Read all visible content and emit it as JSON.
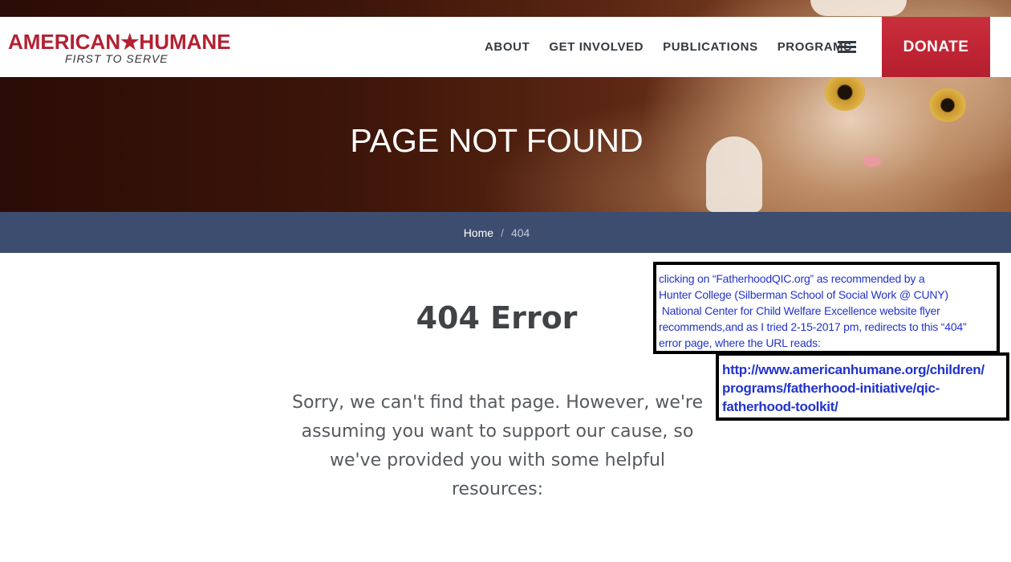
{
  "header": {
    "logo_main": "AMERICAN★HUMANE",
    "logo_tagline": "FIRST TO SERVE",
    "nav": [
      "ABOUT",
      "GET INVOLVED",
      "PUBLICATIONS",
      "PROGRAMS"
    ],
    "menu_icon": "hamburger-menu-icon",
    "donate_label": "DONATE"
  },
  "hero": {
    "title": "PAGE NOT FOUND"
  },
  "breadcrumb": {
    "home": "Home",
    "separator": "/",
    "current": "404"
  },
  "main": {
    "error_title": "404 Error",
    "error_message": "Sorry, we can't find that page. However, we're assuming you want to support our cause, so we've provided you with some helpful resources:"
  },
  "annotations": {
    "note": "clicking on “FatherhoodQIC.org” as recommended by a\nHunter College (Silberman School of Social Work @ CUNY)\n National Center for Child Welfare Excellence website flyer\nrecommends,and as I tried 2-15-2017 pm, redirects to this “404”\nerror page, where the URL reads:",
    "url": "http://www.americanhumane.org/children/\nprograms/fatherhood-initiative/qic-\nfatherhood-toolkit/"
  },
  "colors": {
    "brand_red": "#b42032",
    "breadcrumb_bar": "#3c4d70",
    "annotation_text": "#2233cc"
  }
}
